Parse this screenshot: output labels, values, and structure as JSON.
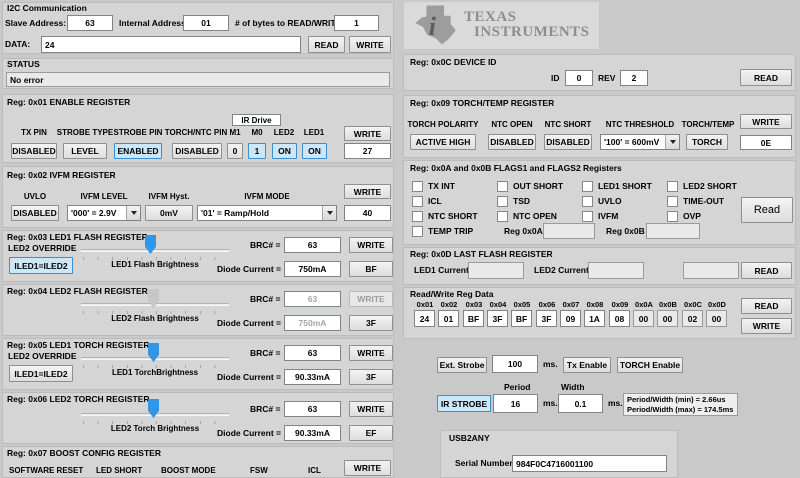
{
  "logo": {
    "line1": "TEXAS",
    "line2": "INSTRUMENTS"
  },
  "i2c": {
    "title": "I2C Communication",
    "slave_label": "Slave Address:",
    "slave": "63",
    "internal_label": "Internal Address:",
    "internal": "01",
    "bytes_label": "# of bytes to READ/WRITE:",
    "bytes": "1",
    "data_label": "DATA:",
    "data": "24",
    "read": "READ",
    "write": "WRITE"
  },
  "status": {
    "title": "STATUS",
    "value": "No error"
  },
  "reg01": {
    "title": "Reg: 0x01 ENABLE REGISTER",
    "ir_drive": "IR Drive",
    "write": "WRITE",
    "value": "27",
    "cols": [
      {
        "label": "TX PIN",
        "value": "DISABLED"
      },
      {
        "label": "STROBE TYPE",
        "value": "LEVEL"
      },
      {
        "label": "STROBE PIN",
        "value": "ENABLED"
      },
      {
        "label": "TORCH/NTC PIN",
        "value": "DISABLED"
      },
      {
        "label": "M1",
        "value": "0"
      },
      {
        "label": "M0",
        "value": "1"
      },
      {
        "label": "LED2",
        "value": "ON"
      },
      {
        "label": "LED1",
        "value": "ON"
      }
    ]
  },
  "reg02": {
    "title": "Reg: 0x02 IVFM REGISTER",
    "uvlo_label": "UVLO",
    "uvlo": "DISABLED",
    "level_label": "IVFM LEVEL",
    "level": "'000' = 2.9V",
    "hyst_label": "IVFM Hyst.",
    "hyst": "0mV",
    "mode_label": "IVFM MODE",
    "mode": "'01' = Ramp/Hold",
    "write": "WRITE",
    "value": "40"
  },
  "reg03": {
    "title": "Reg: 0x03 LED1 FLASH REGISTER",
    "override_label": "LED2 OVERRIDE",
    "override_btn": "ILED1=ILED2",
    "slider_label": "LED1 Flash Brightness",
    "brc_label": "BRC# =",
    "brc": "63",
    "write": "WRITE",
    "diode_label": "Diode Current =",
    "diode": "750mA",
    "hex": "BF"
  },
  "reg04": {
    "title": "Reg: 0x04 LED2 FLASH REGISTER",
    "slider_label": "LED2 Flash Brightness",
    "brc_label": "BRC# =",
    "brc": "63",
    "write": "WRITE",
    "diode_label": "Diode Current =",
    "diode": "750mA",
    "hex": "3F"
  },
  "reg05": {
    "title": "Reg: 0x05 LED1 TORCH REGISTER",
    "override_label": "LED2 OVERRIDE",
    "override_btn": "ILED1=ILED2",
    "slider_label": "LED1 TorchBrightness",
    "brc_label": "BRC# =",
    "brc": "63",
    "write": "WRITE",
    "diode_label": "Diode Current =",
    "diode": "90.33mA",
    "hex": "3F"
  },
  "reg06": {
    "title": "Reg: 0x06 LED2 TORCH REGISTER",
    "slider_label": "LED2 Torch Brightness",
    "brc_label": "BRC# =",
    "brc": "63",
    "write": "WRITE",
    "diode_label": "Diode Current =",
    "diode": "90.33mA",
    "hex": "EF"
  },
  "reg07": {
    "title": "Reg: 0x07 BOOST CONFIG REGISTER",
    "cols": [
      "SOFTWARE RESET",
      "LED SHORT",
      "BOOST MODE",
      "FSW",
      "ICL"
    ],
    "write": "WRITE"
  },
  "reg0c": {
    "title": "Reg: 0x0C DEVICE ID",
    "id_label": "ID",
    "id": "0",
    "rev_label": "REV",
    "rev": "2",
    "read": "READ"
  },
  "reg09": {
    "title": "Reg: 0x09 TORCH/TEMP REGISTER",
    "cols": [
      {
        "label": "TORCH POLARITY",
        "value": "ACTIVE HIGH"
      },
      {
        "label": "NTC OPEN",
        "value": "DISABLED"
      },
      {
        "label": "NTC SHORT",
        "value": "DISABLED"
      }
    ],
    "threshold_label": "NTC THRESHOLD",
    "threshold": "'100' = 600mV",
    "torchtemp_label": "TORCH/TEMP",
    "torchtemp": "TORCH",
    "write": "WRITE",
    "value": "0E"
  },
  "flags": {
    "title": "Reg: 0x0A and 0x0B FLAGS1 and FLAGS2 Registers",
    "items": [
      "TX INT",
      "OUT SHORT",
      "LED1 SHORT",
      "LED2 SHORT",
      "ICL",
      "TSD",
      "UVLO",
      "TIME-OUT",
      "NTC SHORT",
      "NTC OPEN",
      "IVFM",
      "OVP",
      "TEMP TRIP"
    ],
    "reg0a_label": "Reg 0x0A",
    "reg0b_label": "Reg 0x0B",
    "read": "Read"
  },
  "reg0d": {
    "title": "Reg: 0x0D LAST FLASH REGISTER",
    "led1_label": "LED1 Current",
    "led2_label": "LED2 Current",
    "read": "READ"
  },
  "regdata": {
    "title": "Read/Write Reg Data",
    "headers": [
      "0x01",
      "0x02",
      "0x03",
      "0x04",
      "0x05",
      "0x06",
      "0x07",
      "0x08",
      "0x09",
      "0x0A",
      "0x0B",
      "0x0C",
      "0x0D"
    ],
    "values": [
      "24",
      "01",
      "BF",
      "3F",
      "BF",
      "3F",
      "09",
      "1A",
      "08",
      "00",
      "00",
      "02",
      "00"
    ],
    "read": "READ",
    "write": "WRITE"
  },
  "strobe": {
    "ext_btn": "Ext. Strobe",
    "ext_value": "100",
    "ms": "ms.",
    "tx_btn": "Tx Enable",
    "torch_btn": "TORCH Enable",
    "period_label": "Period",
    "width_label": "Width",
    "ir_btn": "IR STROBE",
    "period": "16",
    "width": "0.1",
    "info1": "Period/Width (min) = 2.66us",
    "info2": "Period/Width (max) = 174.5ms"
  },
  "usb2any": {
    "title": "USB2ANY",
    "serial_label": "Serial Number:",
    "serial": "984F0C4716001100"
  }
}
